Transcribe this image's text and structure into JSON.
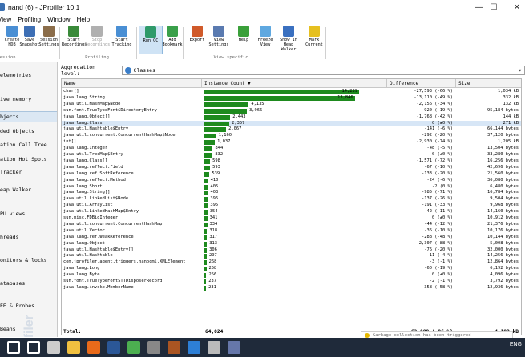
{
  "window": {
    "title": "nand (6) - JProfiler 10.1",
    "minimize": "—",
    "maximize": "☐",
    "close": "✕"
  },
  "menu": [
    "View",
    "Profiling",
    "Window",
    "Help"
  ],
  "toolbar": {
    "buttons": [
      {
        "label": "Create\nHDB",
        "color": "#4a8fd4",
        "state": "normal"
      },
      {
        "label": "Save\nSnapshot",
        "color": "#3d6fb5",
        "state": "normal"
      },
      {
        "label": "Session\nSettings",
        "color": "#8b6d4a",
        "state": "normal"
      },
      {
        "label": "Start\nRecordings",
        "color": "#3a8a3a",
        "state": "normal"
      },
      {
        "label": "Stop\nRecordings",
        "color": "#b0b0b0",
        "state": "disabled"
      },
      {
        "label": "Start\nTracking",
        "color": "#4a8fd4",
        "state": "normal"
      },
      {
        "label": "Run GC",
        "color": "#2f9a6a",
        "state": "selected"
      },
      {
        "label": "Add\nBookmark",
        "color": "#3aa04a",
        "state": "normal"
      },
      {
        "label": "Export",
        "color": "#d05a2a",
        "state": "normal"
      },
      {
        "label": "View\nSettings",
        "color": "#5a7ab0",
        "state": "normal"
      },
      {
        "label": "Help",
        "color": "#3aa03a",
        "state": "normal"
      },
      {
        "label": "Freeze\nView",
        "color": "#5fa8e0",
        "state": "normal"
      },
      {
        "label": "Show In\nHeap Walker",
        "color": "#3a70c0",
        "state": "normal"
      },
      {
        "label": "Mark\nCurrent",
        "color": "#e6c020",
        "state": "normal"
      }
    ],
    "groups": [
      "Session",
      "Profiling",
      "View specific"
    ]
  },
  "sidebar": {
    "items": [
      "elemetries",
      "ive memory",
      "bjects",
      "ded Objects",
      "ation Call Tree",
      "ation Hot Spots",
      "Tracker",
      "eap Walker",
      "PU views",
      "hreads",
      "onitors & locks",
      "atabases",
      "EE & Probes",
      "Beans"
    ],
    "selected_index": 2,
    "watermark": "JProfiler"
  },
  "aggregation": {
    "label": "Aggregation level:",
    "value": "Classes"
  },
  "table": {
    "headers": {
      "name": "Name",
      "count": "Instance Count ▼",
      "diff": "Difference",
      "size": "Size"
    },
    "max_count": 14239,
    "rows": [
      {
        "name": "char[]",
        "count": 14239,
        "count_text": "14,239",
        "diff": "-27,593  (-66 %)",
        "size": "1,034 kB"
      },
      {
        "name": "java.lang.String",
        "count": 13846,
        "count_text": "13,846",
        "diff": "-13,110  (-49 %)",
        "size": "332 kB"
      },
      {
        "name": "java.util.HashMap$Node",
        "count": 4135,
        "count_text": "4,135",
        "diff": "-2,156  (-34 %)",
        "size": "132 kB"
      },
      {
        "name": "sun.font.TrueTypeFont$DirectoryEntry",
        "count": 3966,
        "count_text": "3,966",
        "diff": "-920  (-19 %)",
        "size": "95,184 bytes"
      },
      {
        "name": "java.lang.Object[]",
        "count": 2443,
        "count_text": "2,443",
        "diff": "-1,768  (-42 %)",
        "size": "144 kB"
      },
      {
        "name": "java.lang.Class",
        "count": 2357,
        "count_text": "2,357",
        "diff": "0  (±0 %)",
        "size": "271 kB"
      },
      {
        "name": "java.util.Hashtable$Entry",
        "count": 2067,
        "count_text": "2,067",
        "diff": "-141  (-6 %)",
        "size": "66,144 bytes"
      },
      {
        "name": "java.util.concurrent.ConcurrentHashMap$Node",
        "count": 1160,
        "count_text": "1,160",
        "diff": "-292  (-20 %)",
        "size": "37,120 bytes"
      },
      {
        "name": "int[]",
        "count": 1037,
        "count_text": "1,037",
        "diff": "-2,930  (-74 %)",
        "size": "1,205 kB"
      },
      {
        "name": "java.lang.Integer",
        "count": 844,
        "count_text": "844",
        "diff": "-48  (-5 %)",
        "size": "13,504 bytes"
      },
      {
        "name": "java.util.TreeMap$Entry",
        "count": 832,
        "count_text": "832",
        "diff": "0  (±0 %)",
        "size": "33,280 bytes"
      },
      {
        "name": "java.lang.Class[]",
        "count": 598,
        "count_text": "598",
        "diff": "-1,571  (-72 %)",
        "size": "16,256 bytes"
      },
      {
        "name": "java.lang.reflect.Field",
        "count": 593,
        "count_text": "593",
        "diff": "-67  (-10 %)",
        "size": "42,696 bytes"
      },
      {
        "name": "java.lang.ref.SoftReference",
        "count": 539,
        "count_text": "539",
        "diff": "-133  (-20 %)",
        "size": "21,560 bytes"
      },
      {
        "name": "java.lang.reflect.Method",
        "count": 410,
        "count_text": "410",
        "diff": "-24  (-6 %)",
        "size": "36,080 bytes"
      },
      {
        "name": "java.lang.Short",
        "count": 405,
        "count_text": "405",
        "diff": "-2  (0 %)",
        "size": "6,480 bytes"
      },
      {
        "name": "java.lang.String[]",
        "count": 403,
        "count_text": "403",
        "diff": "-985  (-71 %)",
        "size": "16,784 bytes"
      },
      {
        "name": "java.util.LinkedList$Node",
        "count": 396,
        "count_text": "396",
        "diff": "-137  (-26 %)",
        "size": "9,504 bytes"
      },
      {
        "name": "java.util.ArrayList",
        "count": 395,
        "count_text": "395",
        "diff": "-191  (-33 %)",
        "size": "9,968 bytes"
      },
      {
        "name": "java.util.LinkedHashMap$Entry",
        "count": 354,
        "count_text": "354",
        "diff": "-42  (-11 %)",
        "size": "14,160 bytes"
      },
      {
        "name": "sun.misc.FDBigInteger",
        "count": 341,
        "count_text": "341",
        "diff": "0  (±0 %)",
        "size": "10,912 bytes"
      },
      {
        "name": "java.util.concurrent.ConcurrentHashMap",
        "count": 334,
        "count_text": "334",
        "diff": "-44  (-12 %)",
        "size": "21,376 bytes"
      },
      {
        "name": "java.util.Vector",
        "count": 318,
        "count_text": "318",
        "diff": "-36  (-10 %)",
        "size": "10,176 bytes"
      },
      {
        "name": "java.lang.ref.WeakReference",
        "count": 317,
        "count_text": "317",
        "diff": "-288  (-48 %)",
        "size": "10,144 bytes"
      },
      {
        "name": "java.lang.Object",
        "count": 313,
        "count_text": "313",
        "diff": "-2,307  (-88 %)",
        "size": "5,008 bytes"
      },
      {
        "name": "java.util.Hashtable$Entry[]",
        "count": 306,
        "count_text": "306",
        "diff": "-76  (-20 %)",
        "size": "32,000 bytes"
      },
      {
        "name": "java.util.Hashtable",
        "count": 297,
        "count_text": "297",
        "diff": "-11  (-4 %)",
        "size": "14,256 bytes"
      },
      {
        "name": "com.jprofiler.agent.triggers.nanocml.XMLElement",
        "count": 268,
        "count_text": "268",
        "diff": "-3  (-1 %)",
        "size": "12,864 bytes"
      },
      {
        "name": "java.lang.Long",
        "count": 258,
        "count_text": "258",
        "diff": "-60  (-19 %)",
        "size": "6,192 bytes"
      },
      {
        "name": "java.lang.Byte",
        "count": 256,
        "count_text": "256",
        "diff": "0  (±0 %)",
        "size": "4,096 bytes"
      },
      {
        "name": "sun.font.TrueTypeFont$TTDisposerRecord",
        "count": 237,
        "count_text": "237",
        "diff": "-2  (-1 %)",
        "size": "3,792 bytes"
      },
      {
        "name": "java.lang.invoke.MemberName",
        "count": 231,
        "count_text": "231",
        "diff": "-358  (-58 %)",
        "size": "12,936 bytes"
      }
    ],
    "selected_row": 5,
    "total": {
      "label": "Total:",
      "count": "64,024",
      "diff": "-62,089  (-96 %)",
      "size": "4,193 kB"
    }
  },
  "notification": "Garbage collection has been triggered",
  "taskbar": {
    "time": "ENG",
    "icons": [
      "windows-start",
      "search",
      "task-view",
      "file-explorer",
      "firefox",
      "word",
      "chrome",
      "app1",
      "app2",
      "jprofiler",
      "app3",
      "app4"
    ]
  }
}
